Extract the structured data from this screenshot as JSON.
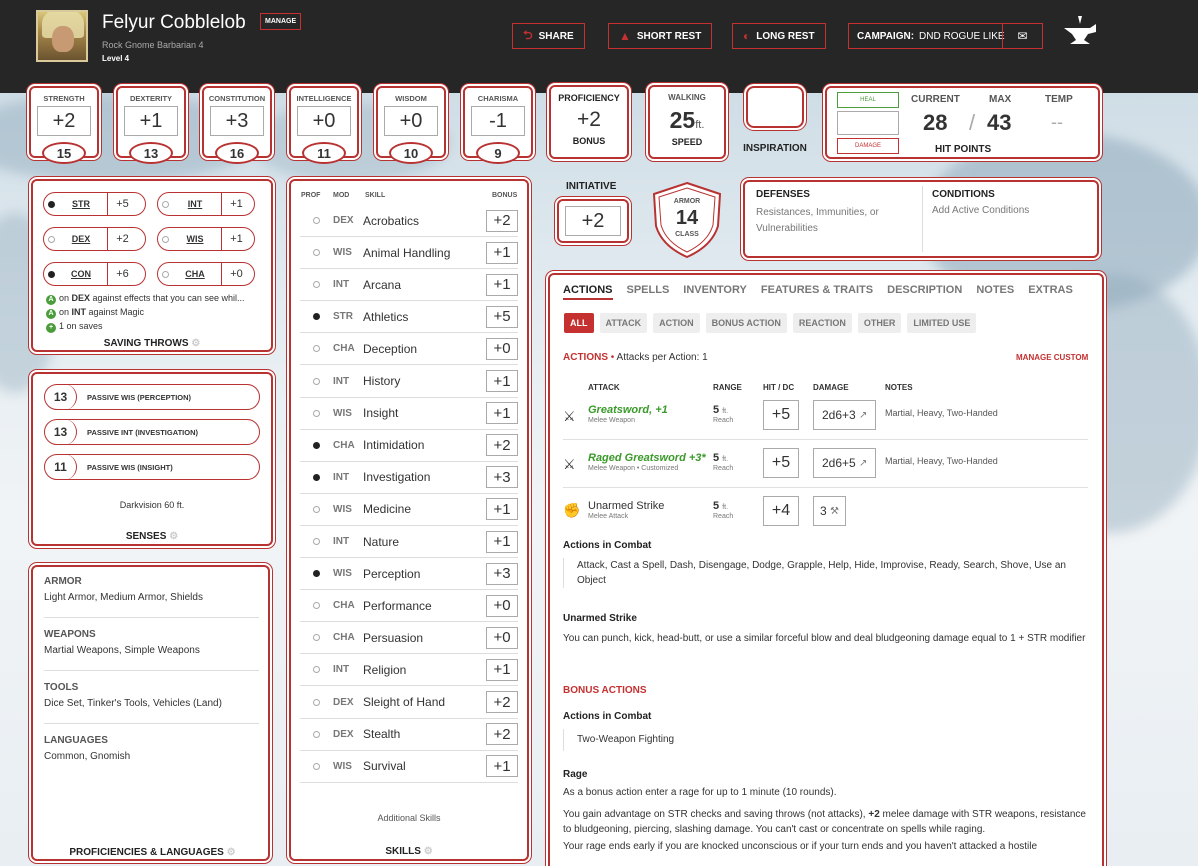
{
  "header": {
    "name": "Felyur Cobblelob",
    "manage": "MANAGE",
    "race_class": "Rock Gnome  Barbarian 4",
    "level": "Level 4",
    "share": "SHARE",
    "short_rest": "SHORT REST",
    "long_rest": "LONG REST",
    "campaign_label": "CAMPAIGN:",
    "campaign_value": "DND ROGUE LIKE"
  },
  "abilities": [
    {
      "name": "STRENGTH",
      "mod": "+2",
      "score": "15"
    },
    {
      "name": "DEXTERITY",
      "mod": "+1",
      "score": "13"
    },
    {
      "name": "CONSTITUTION",
      "mod": "+3",
      "score": "16"
    },
    {
      "name": "INTELLIGENCE",
      "mod": "+0",
      "score": "11"
    },
    {
      "name": "WISDOM",
      "mod": "+0",
      "score": "10"
    },
    {
      "name": "CHARISMA",
      "mod": "-1",
      "score": "9"
    }
  ],
  "proficiency": {
    "label": "PROFICIENCY",
    "value": "+2",
    "sub": "BONUS"
  },
  "speed": {
    "label": "WALKING",
    "value": "25",
    "unit": "ft.",
    "sub": "SPEED"
  },
  "inspiration": {
    "label": "INSPIRATION"
  },
  "hp": {
    "heal": "HEAL",
    "damage": "DAMAGE",
    "current_label": "CURRENT",
    "max_label": "MAX",
    "temp_label": "TEMP",
    "current": "28",
    "sep": "/",
    "max": "43",
    "temp": "--",
    "title": "HIT POINTS"
  },
  "initiative": {
    "label": "INITIATIVE",
    "value": "+2"
  },
  "armor": {
    "top": "ARMOR",
    "value": "14",
    "bottom": "CLASS"
  },
  "defenses": {
    "title": "DEFENSES",
    "text": "Resistances, Immunities, or Vulnerabilities"
  },
  "conditions": {
    "title": "CONDITIONS",
    "text": "Add Active Conditions"
  },
  "saves": {
    "items": [
      {
        "ab": "STR",
        "val": "+5"
      },
      {
        "ab": "INT",
        "val": "+1"
      },
      {
        "ab": "DEX",
        "val": "+2"
      },
      {
        "ab": "WIS",
        "val": "+1"
      },
      {
        "ab": "CON",
        "val": "+6"
      },
      {
        "ab": "CHA",
        "val": "+0"
      }
    ],
    "note1_pre": "on ",
    "note1_bold": "DEX",
    "note1_post": " against effects that you can see whil...",
    "note2_pre": "on ",
    "note2_bold": "INT",
    "note2_post": " against Magic",
    "note3": "1 on saves",
    "badge_a": "A",
    "badge_plus": "+",
    "title": "SAVING THROWS"
  },
  "senses": {
    "items": [
      {
        "v": "13",
        "t": "PASSIVE WIS (PERCEPTION)"
      },
      {
        "v": "13",
        "t": "PASSIVE INT (INVESTIGATION)"
      },
      {
        "v": "11",
        "t": "PASSIVE WIS (INSIGHT)"
      }
    ],
    "darkvision": "Darkvision 60 ft.",
    "title": "SENSES"
  },
  "proficiencies": {
    "armor_h": "ARMOR",
    "armor": "Light Armor, Medium Armor, Shields",
    "weapons_h": "WEAPONS",
    "weapons": "Martial Weapons, Simple Weapons",
    "tools_h": "TOOLS",
    "tools": "Dice Set, Tinker's Tools, Vehicles (Land)",
    "languages_h": "LANGUAGES",
    "languages": "Common, Gnomish",
    "title": "PROFICIENCIES & LANGUAGES"
  },
  "skills": {
    "h_prof": "PROF",
    "h_mod": "MOD",
    "h_skill": "SKILL",
    "h_bonus": "BONUS",
    "rows": [
      {
        "p": false,
        "m": "DEX",
        "n": "Acrobatics",
        "b": "+2"
      },
      {
        "p": false,
        "m": "WIS",
        "n": "Animal Handling",
        "b": "+1"
      },
      {
        "p": false,
        "m": "INT",
        "n": "Arcana",
        "b": "+1"
      },
      {
        "p": true,
        "m": "STR",
        "n": "Athletics",
        "b": "+5"
      },
      {
        "p": false,
        "m": "CHA",
        "n": "Deception",
        "b": "+0"
      },
      {
        "p": false,
        "m": "INT",
        "n": "History",
        "b": "+1"
      },
      {
        "p": false,
        "m": "WIS",
        "n": "Insight",
        "b": "+1"
      },
      {
        "p": true,
        "m": "CHA",
        "n": "Intimidation",
        "b": "+2"
      },
      {
        "p": true,
        "m": "INT",
        "n": "Investigation",
        "b": "+3"
      },
      {
        "p": false,
        "m": "WIS",
        "n": "Medicine",
        "b": "+1"
      },
      {
        "p": false,
        "m": "INT",
        "n": "Nature",
        "b": "+1"
      },
      {
        "p": true,
        "m": "WIS",
        "n": "Perception",
        "b": "+3"
      },
      {
        "p": false,
        "m": "CHA",
        "n": "Performance",
        "b": "+0"
      },
      {
        "p": false,
        "m": "CHA",
        "n": "Persuasion",
        "b": "+0"
      },
      {
        "p": false,
        "m": "INT",
        "n": "Religion",
        "b": "+1"
      },
      {
        "p": false,
        "m": "DEX",
        "n": "Sleight of Hand",
        "b": "+2"
      },
      {
        "p": false,
        "m": "DEX",
        "n": "Stealth",
        "b": "+2"
      },
      {
        "p": false,
        "m": "WIS",
        "n": "Survival",
        "b": "+1"
      }
    ],
    "additional": "Additional Skills",
    "title": "SKILLS"
  },
  "tabs": [
    "ACTIONS",
    "SPELLS",
    "INVENTORY",
    "FEATURES & TRAITS",
    "DESCRIPTION",
    "NOTES",
    "EXTRAS"
  ],
  "filters": [
    "ALL",
    "ATTACK",
    "ACTION",
    "BONUS ACTION",
    "REACTION",
    "OTHER",
    "LIMITED USE"
  ],
  "actions": {
    "heading": "ACTIONS",
    "bullet": "•",
    "per_action": "Attacks per Action: 1",
    "manage_custom": "MANAGE CUSTOM",
    "col_attack": "ATTACK",
    "col_range": "RANGE",
    "col_hit": "HIT / DC",
    "col_damage": "DAMAGE",
    "col_notes": "NOTES",
    "attacks": [
      {
        "name": "Greatsword, +1",
        "sub": "Melee Weapon",
        "range": "5",
        "unit": "ft.",
        "reach": "Reach",
        "hit": "+5",
        "damage": "2d6+3",
        "notes": "Martial, Heavy, Two-Handed"
      },
      {
        "name": "Raged Greatsword +3*",
        "sub": "Melee Weapon • Customized",
        "range": "5",
        "unit": "ft.",
        "reach": "Reach",
        "hit": "+5",
        "damage": "2d6+5",
        "notes": "Martial, Heavy, Two-Handed"
      },
      {
        "name": "Unarmed Strike",
        "sub": "Melee Attack",
        "range": "5",
        "unit": "ft.",
        "reach": "Reach",
        "hit": "+4",
        "damage": "3",
        "notes": ""
      }
    ],
    "combat_title": "Actions in Combat",
    "combat_text": "Attack, Cast a Spell, Dash, Disengage, Dodge, Grapple, Help, Hide, Improvise, Ready, Search, Shove, Use an Object",
    "unarmed_title": "Unarmed Strike",
    "unarmed_text": "You can punch, kick, head-butt, or use a similar forceful blow and deal bludgeoning damage equal to 1 + STR modifier",
    "bonus_heading": "BONUS ACTIONS",
    "bonus_combat_title": "Actions in Combat",
    "bonus_combat_text": "Two-Weapon Fighting",
    "rage_title": "Rage",
    "rage_text1": "As a bonus action enter a rage for up to 1 minute (10 rounds).",
    "rage_text2_pre": "You gain advantage on STR checks and saving throws (not attacks), ",
    "rage_text2_bold": "+2",
    "rage_text2_post": " melee damage with STR weapons, resistance to bludgeoning, piercing, slashing damage. You can't cast or concentrate on spells while raging.",
    "rage_text3": "Your rage ends early if you are knocked unconscious or if your turn ends and you haven't attacked a hostile"
  }
}
